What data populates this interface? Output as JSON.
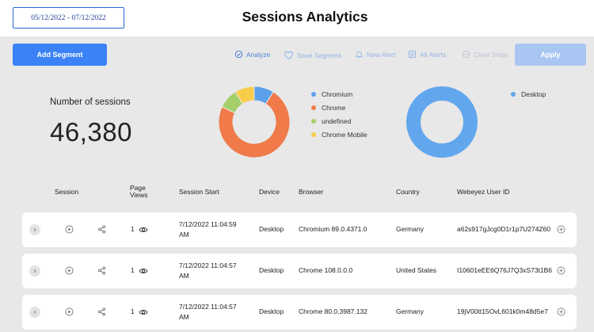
{
  "header": {
    "date_range": "05/12/2022 - 07/12/2022",
    "title": "Sessions Analytics"
  },
  "toolbar": {
    "add_segment": "Add Segment",
    "analyze": "Analyze",
    "save_segment": "Save Segment",
    "new_alert": "New Alert",
    "all_alerts": "All Alerts",
    "clear_steps": "Clear Steps",
    "apply": "Apply"
  },
  "metric": {
    "label": "Number of sessions",
    "value": "46,380"
  },
  "colors": {
    "accent": "#3b82f6",
    "chromium": "#5aa0e8",
    "chrome": "#f07a4a",
    "undefined": "#a4cf6a",
    "chrome_mobile": "#f9cd4c",
    "desktop": "#62a6ee"
  },
  "chart_data": [
    {
      "type": "pie",
      "categories": [
        "Chromium",
        "Chrome",
        "undefined",
        "Chrome Mobile"
      ],
      "values": [
        9,
        73,
        9,
        9
      ],
      "legend": "right"
    },
    {
      "type": "pie",
      "categories": [
        "Desktop"
      ],
      "values": [
        100
      ],
      "legend": "right"
    }
  ],
  "table": {
    "headers": {
      "session": "Session",
      "page_views": "Page Views",
      "session_start": "Session Start",
      "device": "Device",
      "browser": "Browser",
      "country": "Country",
      "user_id": "Webeyez User ID"
    },
    "rows": [
      {
        "page_views": "1",
        "start_line1": "7/12/2022 11:04:59",
        "start_line2": "AM",
        "device": "Desktop",
        "browser": "Chromium 89.0.4371.0",
        "country": "Germany",
        "user_id": "a62s917gJcg0D1r1p7U274Z60"
      },
      {
        "page_views": "1",
        "start_line1": "7/12/2022 11:04:57",
        "start_line2": "AM",
        "device": "Desktop",
        "browser": "Chrome 108.0.0.0",
        "country": "United States",
        "user_id": "I10601eEE6Q76J7Q3xS73t1B6"
      },
      {
        "page_views": "1",
        "start_line1": "7/12/2022 11:04:57",
        "start_line2": "AM",
        "device": "Desktop",
        "browser": "Chrome 80.0.3987.132",
        "country": "Germany",
        "user_id": "19jV00tt15OvL601k0m48d5e7"
      }
    ]
  }
}
